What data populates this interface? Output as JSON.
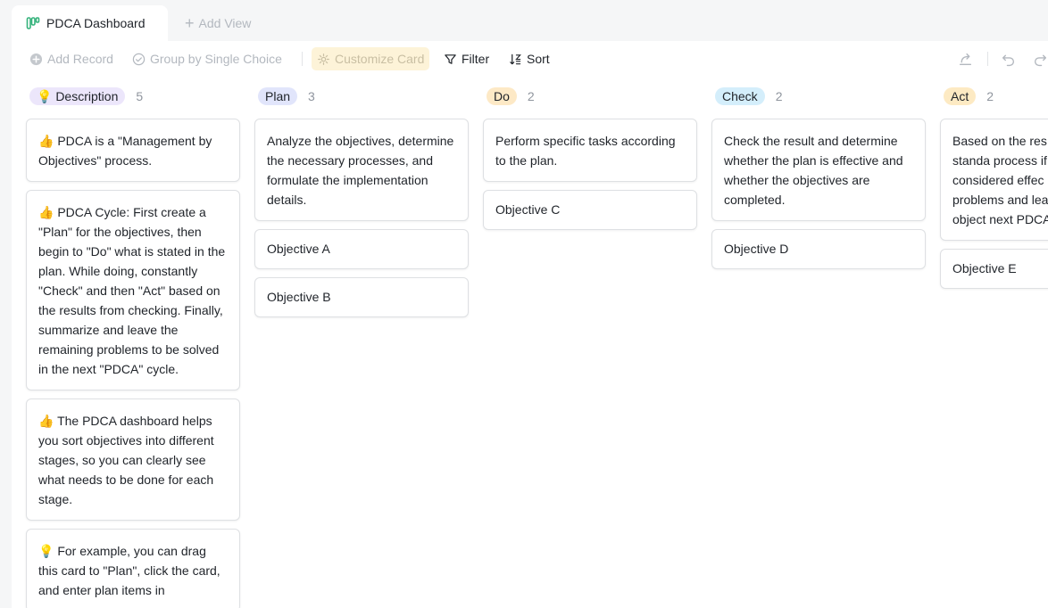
{
  "tabs": {
    "active_label": "PDCA Dashboard",
    "add_view_label": "Add View"
  },
  "toolbar": {
    "add_record": "Add Record",
    "group_by": "Group by Single Choice",
    "customize_card": "Customize Card",
    "filter": "Filter",
    "sort": "Sort"
  },
  "colors": {
    "description": "#ece6fb",
    "plan": "#e1e5fb",
    "do": "#fde9c6",
    "check": "#d4eefb",
    "act": "#fdeac3"
  },
  "columns": [
    {
      "label": "💡 Description",
      "count": "5",
      "cards": [
        "👍 PDCA is a \"Management by Objectives\" process.",
        "👍 PDCA Cycle: First create a \"Plan\" for the objectives, then begin to \"Do\" what is stated in the plan. While doing, constantly \"Check\" and then \"Act\" based on the results from checking. Finally, summarize and leave the remaining problems to be solved in the next \"PDCA\" cycle.",
        "👍 The PDCA dashboard helps you sort objectives into different stages, so you can clearly see what needs to be done for each stage.",
        "💡 For example, you can drag this card to \"Plan\", click the card, and enter plan items in"
      ]
    },
    {
      "label": "Plan",
      "count": "3",
      "cards": [
        "Analyze the objectives, determine the necessary processes, and formulate the implementation details.",
        "Objective A",
        "Objective B"
      ]
    },
    {
      "label": "Do",
      "count": "2",
      "cards": [
        "Perform specific tasks according to the plan.",
        "Objective C"
      ]
    },
    {
      "label": "Check",
      "count": "2",
      "cards": [
        "Check the result and determine whether the plan is effective and whether the objectives are completed.",
        "Objective D"
      ]
    },
    {
      "label": "Act",
      "count": "2",
      "cards": [
        "Based on the res checking, standa process if the pla considered effec is ineffective, su problems and lea remaining object next PDCA cycle",
        "Objective E"
      ]
    }
  ]
}
